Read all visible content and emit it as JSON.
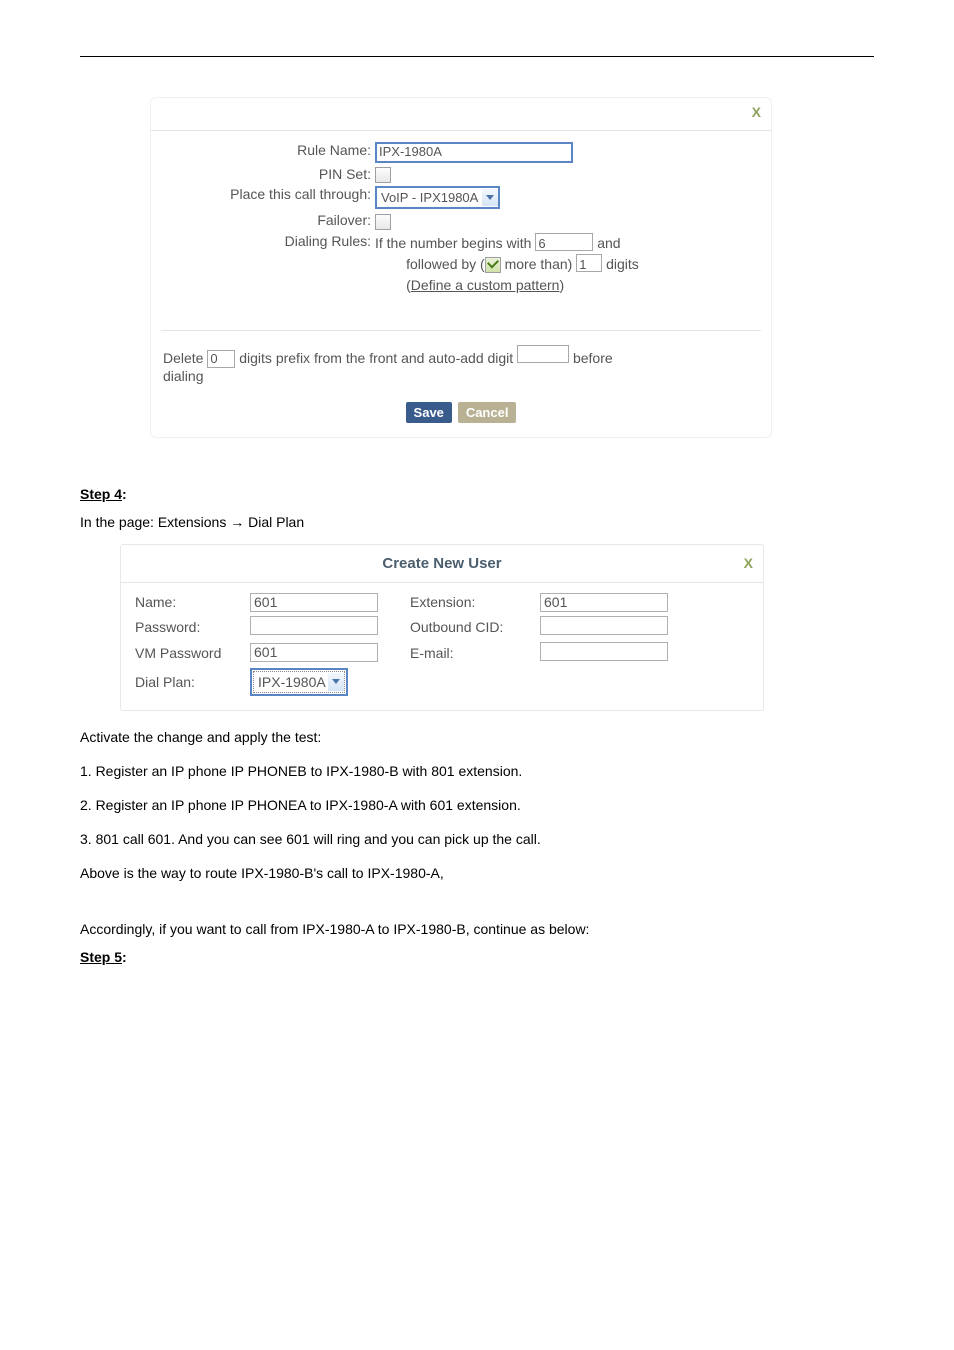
{
  "dialog1": {
    "closeLabel": "X",
    "ruleName": {
      "label": "Rule Name:",
      "value": "IPX-1980A"
    },
    "pinSet": {
      "label": "PIN Set:"
    },
    "placeThrough": {
      "label": "Place this call through:",
      "value": "VoIP - IPX1980A"
    },
    "failover": {
      "label": "Failover:"
    },
    "dialingRules": {
      "label": "Dialing Rules:",
      "textA": "If the number begins with",
      "beginsWith": "6",
      "textB": "and",
      "textC": "followed by (",
      "textD": "more than)",
      "followDigits": "1",
      "textE": "digits",
      "patternLink": "Define a custom pattern",
      "patternWrapL": "(",
      "patternWrapR": ")"
    },
    "deleteLine": {
      "deleteLabel": "Delete",
      "deleteVal": "0",
      "mid": "digits prefix from the front and auto-add digit",
      "addVal": "",
      "before": "before",
      "dialing": "dialing"
    },
    "buttons": {
      "save": "Save",
      "cancel": "Cancel"
    }
  },
  "step4": {
    "heading": "Step 4",
    "colon": ":",
    "line": "In the page: Extensions → Dial Plan"
  },
  "dialog2": {
    "title": "Create New User",
    "closeLabel": "X",
    "name": {
      "label": "Name:",
      "value": "601"
    },
    "extension": {
      "label": "Extension:",
      "value": "601"
    },
    "password": {
      "label": "Password:",
      "value": ""
    },
    "outboundCid": {
      "label": "Outbound CID:",
      "value": ""
    },
    "vmPassword": {
      "label": "VM Password",
      "value": "601"
    },
    "email": {
      "label": "E-mail:",
      "value": ""
    },
    "dialPlan": {
      "label": "Dial Plan:",
      "value": "IPX-1980A"
    }
  },
  "afterText": {
    "l1": "Activate the change and apply the test:",
    "l2": "1. Register an IP phone IP PHONEB to IPX-1980-B with 801 extension.",
    "l3": "2. Register an IP phone IP PHONEA to IPX-1980-A with 601 extension.",
    "l4": "3. 801 call 601. And you can see 601 will ring and you can pick up the call.",
    "l5": "Above is the way to route IPX-1980-B's call to IPX-1980-A,",
    "l6": "Accordingly, if you want to call from IPX-1980-A to IPX-1980-B, continue as below:",
    "step5": "Step 5",
    "colon": ":"
  }
}
